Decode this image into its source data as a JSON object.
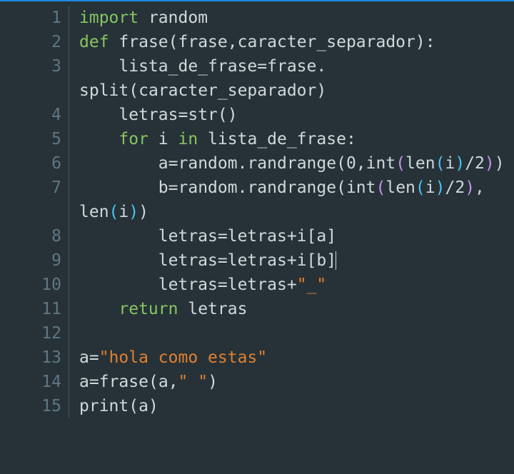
{
  "lines": {
    "ln1": "1",
    "ln2": "2",
    "ln3": "3",
    "ln4": "4",
    "ln5": "5",
    "ln6": "6",
    "ln7": "7",
    "ln8": "8",
    "ln9": "9",
    "ln10": "10",
    "ln11": "11",
    "ln12": "12",
    "ln13": "13",
    "ln14": "14",
    "ln15": "15"
  },
  "code": {
    "l1": {
      "kw_import": "import",
      "sp": " ",
      "random": "random"
    },
    "l2": {
      "kw_def": "def",
      "sp": " ",
      "fname": "frase",
      "op_paren_o": "(",
      "arg1": "frase",
      "comma": ",",
      "arg2": "caracter_separador",
      "op_paren_c": ")",
      "colon": ":"
    },
    "l3": {
      "indent": "    ",
      "lhs": "lista_de_frase",
      "eq": "=",
      "rhs1": "frase",
      "dot": "."
    },
    "l3b": {
      "call": "split",
      "op_paren_o": "(",
      "arg": "caracter_separador",
      "op_paren_c": ")"
    },
    "l4": {
      "indent": "    ",
      "lhs": "letras",
      "eq": "=",
      "call": "str",
      "op_paren_o": "(",
      "op_paren_c": ")"
    },
    "l5": {
      "indent": "    ",
      "kw_for": "for",
      "sp": " ",
      "var": "i",
      "sp2": " ",
      "kw_in": "in",
      "sp3": " ",
      "iter": "lista_de_frase",
      "colon": ":"
    },
    "l6": {
      "indent": "        ",
      "lhs": "a",
      "eq": "=",
      "obj": "random",
      "dot": ".",
      "meth": "randrange",
      "p1o": "(",
      "z": "0",
      "comma": ",",
      "intc": "int",
      "p2o": "(",
      "lenc": "len",
      "p3o": "(",
      "i": "i",
      "p3c": ")",
      "slash": "/",
      "two": "2",
      "p2c": ")",
      "p1c": ")"
    },
    "l7": {
      "indent": "        ",
      "lhs": "b",
      "eq": "=",
      "obj": "random",
      "dot": ".",
      "meth": "randrange",
      "p1o": "(",
      "intc": "int",
      "p2o": "(",
      "lenc": "len",
      "p3o": "(",
      "i": "i",
      "p3c": ")",
      "slash": "/",
      "two": "2",
      "p2c": ")",
      "comma": ","
    },
    "l7b": {
      "lenc": "len",
      "p2o": "(",
      "i": "i",
      "p2c": ")",
      "p1c": ")"
    },
    "l8": {
      "indent": "        ",
      "lhs": "letras",
      "eq": "=",
      "r1": "letras",
      "plus": "+",
      "i": "i",
      "bo": "[",
      "a": "a",
      "bc": "]"
    },
    "l9": {
      "indent": "        ",
      "lhs": "letras",
      "eq": "=",
      "r1": "letras",
      "plus": "+",
      "i": "i",
      "bo": "[",
      "b": "b",
      "bc": "]"
    },
    "l10": {
      "indent": "        ",
      "lhs": "letras",
      "eq": "=",
      "r1": "letras",
      "plus": "+",
      "str": "\"_\""
    },
    "l11": {
      "indent": "    ",
      "kw_return": "return",
      "sp": " ",
      "val": "letras"
    },
    "l12": {
      "empty": ""
    },
    "l13": {
      "lhs": "a",
      "eq": "=",
      "str": "\"hola como estas\""
    },
    "l14": {
      "lhs": "a",
      "eq": "=",
      "call": "frase",
      "po": "(",
      "arg1": "a",
      "comma": ",",
      "str": "\" \"",
      "pc": ")"
    },
    "l15": {
      "call": "print",
      "po": "(",
      "arg": "a",
      "pc": ")"
    }
  }
}
